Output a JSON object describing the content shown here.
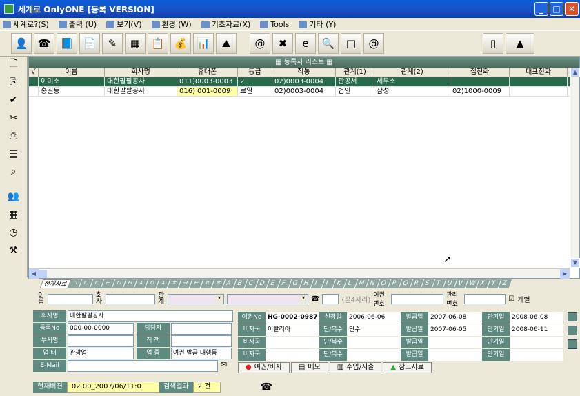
{
  "window": {
    "title": "세계로 OnlyONE [등록 VERSION]"
  },
  "menu": [
    "세계로?(S)",
    "출력 (U)",
    "보기(V)",
    "환경 (W)",
    "기초자료(X)",
    "Tools",
    "기타 (Y)"
  ],
  "toolbar_icons": [
    "user-icon",
    "phone-icon",
    "book-icon",
    "doc-icon",
    "edit-icon",
    "calendar-icon",
    "notes-icon",
    "money-icon",
    "chart-icon",
    "person-icon",
    "mail-icon",
    "excel-icon",
    "ie-icon",
    "search-icon",
    "clipboard-icon",
    "at-icon",
    "exit-icon",
    "company-logo-icon"
  ],
  "sidebar_icons": [
    "new-doc-icon",
    "copy-icon",
    "check-icon",
    "cut-icon",
    "print-icon",
    "save-icon",
    "search-icon",
    "group-icon",
    "sheet-icon",
    "schedule-icon",
    "tools-icon"
  ],
  "grid": {
    "title": "등록자 리스트",
    "columns": [
      "√",
      "이름",
      "회사명",
      "휴대폰",
      "등급",
      "직통",
      "관계(1)",
      "관계(2)",
      "집전화",
      "대표전화"
    ],
    "rows": [
      [
        "",
        "이미소",
        "대한팔팔공사",
        "011)0003-0003",
        "2",
        "02)0003-0004",
        "관공서",
        "세무소",
        "",
        ""
      ],
      [
        "",
        "홍길동",
        "대한팔팔공사",
        "016) 001-0009",
        "로얄",
        "02)0003-0004",
        "법인",
        "삼성",
        "02)1000-0009",
        ""
      ]
    ]
  },
  "tabs": [
    "전체자료",
    "ㄱ",
    "ㄴ",
    "ㄷ",
    "ㄹ",
    "ㅁ",
    "ㅂ",
    "ㅅ",
    "ㅇ",
    "ㅈ",
    "ㅊ",
    "ㅋ",
    "ㅌ",
    "ㅍ",
    "ㅎ",
    "A",
    "B",
    "C",
    "D",
    "E",
    "F",
    "G",
    "H",
    "I",
    "J",
    "K",
    "L",
    "M",
    "N",
    "O",
    "P",
    "Q",
    "R",
    "S",
    "T",
    "U",
    "V",
    "W",
    "X",
    "Y",
    "Z"
  ],
  "search": {
    "name_label": "이름",
    "company_label": "회사",
    "rel_label": "관계",
    "phone_hint": "(끝4자리)",
    "passport_label": "여권번호",
    "manage_label": "관리번호",
    "individual_label": "개별"
  },
  "detail": {
    "company_label": "회사명",
    "company": "대한팔팔공사",
    "regno_label": "등록No",
    "regno": "000-00-0000",
    "manager_label": "담당자",
    "manager": "",
    "dept_label": "부서명",
    "dept": "",
    "position_label": "직 책",
    "position": "",
    "biz_label": "업 태",
    "biz": "관광업",
    "type_label": "업 종",
    "type": "여권 발급 대행등",
    "email_label": "E-Mail",
    "email": ""
  },
  "passport": {
    "no_label": "여권No",
    "no": "HG-0002-0987",
    "apply_label": "신청일",
    "apply": "2006-06-06",
    "issue_label": "발급일",
    "issue": "2007-06-08",
    "expire_label": "만기일",
    "expire": "2008-06-08",
    "visa1_label": "비자국",
    "visa1": "이탈리아",
    "single1_label": "단/복수",
    "single1": "단수",
    "issue2_label": "발급일",
    "issue2": "2007-06-05",
    "expire2_label": "만기일",
    "expire2": "2008-06-11",
    "visa2_label": "비자국",
    "single2_label": "단/복수",
    "issue3_label": "발급일",
    "expire3_label": "만기일",
    "visa3_label": "비자국",
    "single3_label": "단/복수",
    "issue4_label": "발급일",
    "expire4_label": "만기일"
  },
  "bottom_tabs": [
    "여권/비자",
    "메모",
    "수입/지출",
    "참고자료"
  ],
  "status": {
    "version_label": "현재버젼",
    "version": "02.00_2007/06/11:0",
    "result_label": "검색결과",
    "result": "2 건"
  },
  "colors": {
    "accent": "#5e8a80",
    "selected_row": "#2a6a4c",
    "highlight": "#ffffa8"
  }
}
